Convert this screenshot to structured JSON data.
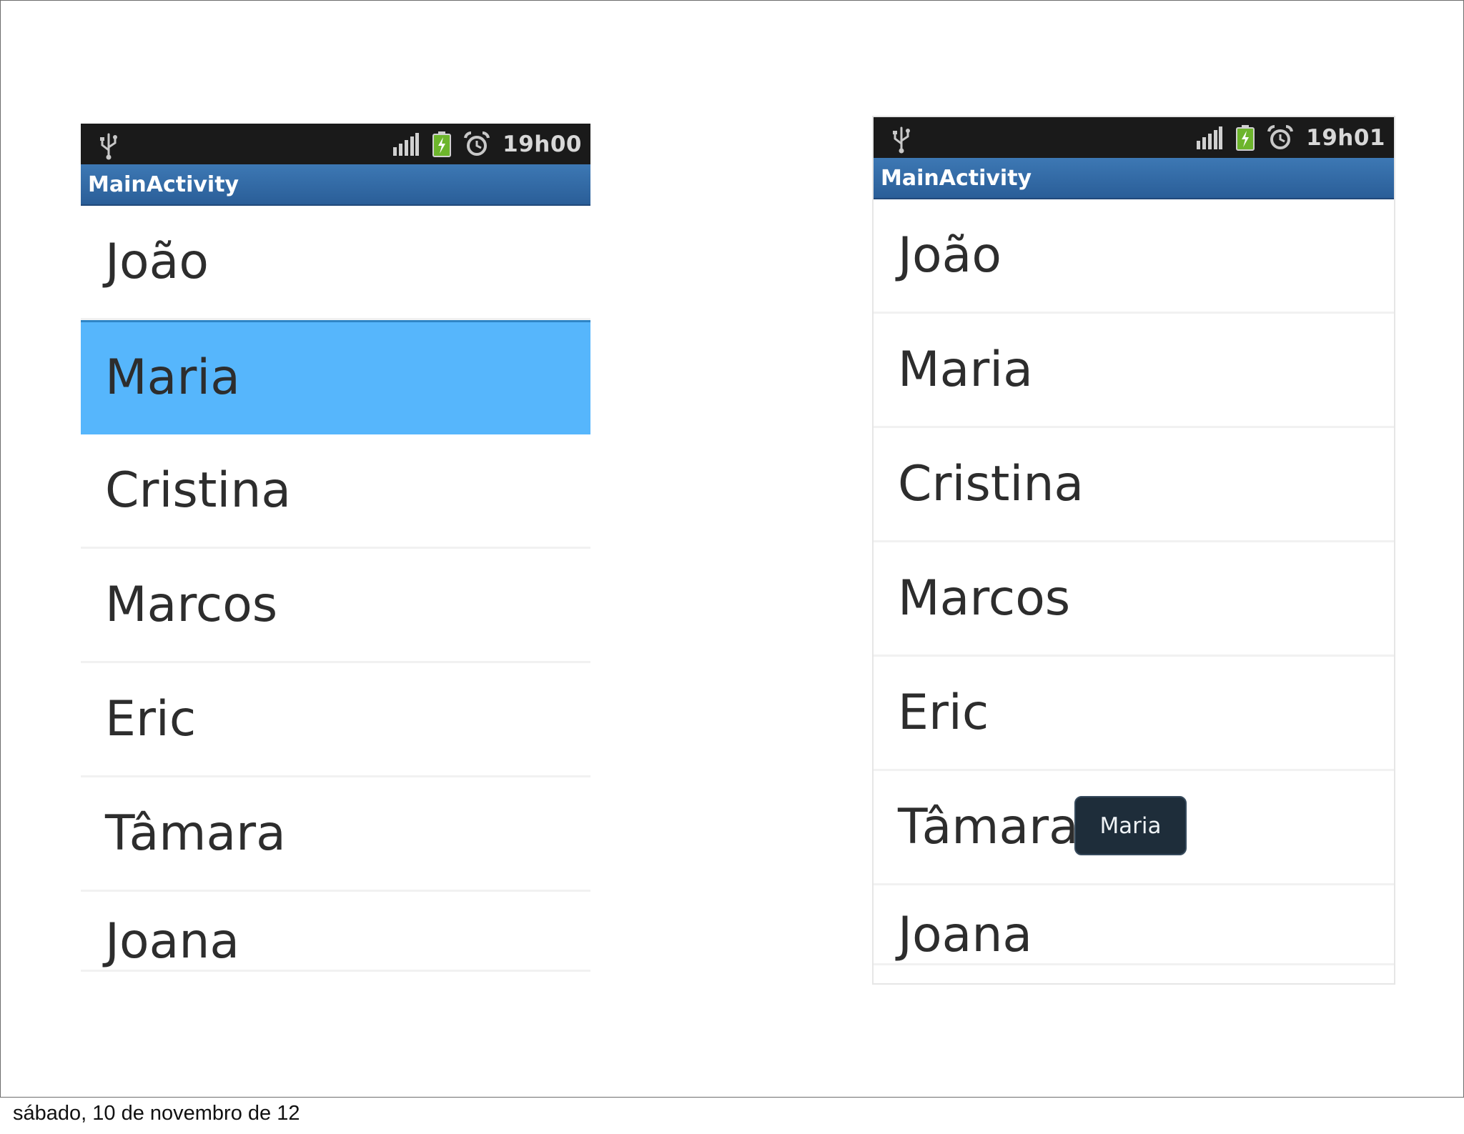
{
  "footer": {
    "date_text": "sábado, 10 de novembro de 12"
  },
  "screens": [
    {
      "status_bar": {
        "time": "19h00",
        "icons": [
          "usb-icon",
          "signal-icon",
          "battery-charging-icon",
          "alarm-icon"
        ]
      },
      "title_bar": {
        "title": "MainActivity"
      },
      "list": {
        "selected_item": "Maria",
        "items": [
          "João",
          "Maria",
          "Cristina",
          "Marcos",
          "Eric",
          "Tâmara",
          "Joana"
        ]
      }
    },
    {
      "status_bar": {
        "time": "19h01",
        "icons": [
          "usb-icon",
          "signal-icon",
          "battery-charging-icon",
          "alarm-icon"
        ]
      },
      "title_bar": {
        "title": "MainActivity"
      },
      "list": {
        "items": [
          "João",
          "Maria",
          "Cristina",
          "Marcos",
          "Eric",
          "Tâmara",
          "Joana"
        ]
      },
      "toast": {
        "text": "Maria"
      }
    }
  ],
  "colors": {
    "status_bar": "#1a1a1a",
    "title_bar": "#2f6aa6",
    "selection_highlight": "#56b6fc",
    "toast_background": "#1e2d3a"
  }
}
